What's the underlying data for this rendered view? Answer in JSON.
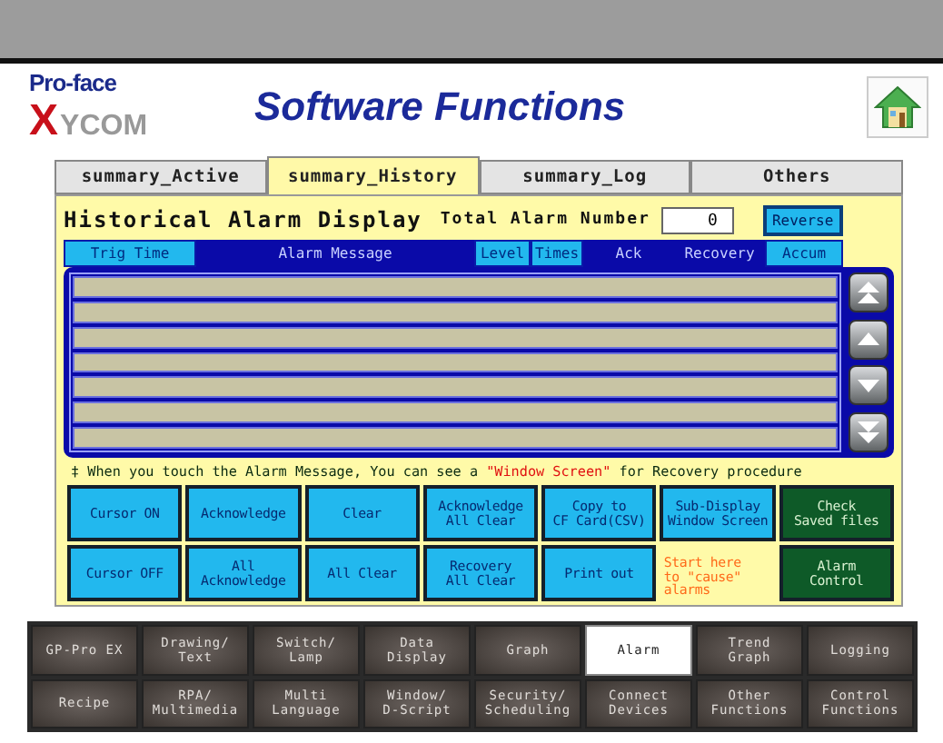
{
  "logo": {
    "top": "Pro-face",
    "mark": "X",
    "bottom": "YCOM"
  },
  "title": "Software Functions",
  "tabs": [
    {
      "label": "summary_Active",
      "selected": false
    },
    {
      "label": "summary_History",
      "selected": true
    },
    {
      "label": "summary_Log",
      "selected": false
    },
    {
      "label": "Others",
      "selected": false
    }
  ],
  "panel": {
    "heading": "Historical Alarm Display",
    "total_label": "Total Alarm Number",
    "total_value": "0",
    "reverse": "Reverse"
  },
  "columns": [
    {
      "label": "Trig Time",
      "kind": "button"
    },
    {
      "label": "Alarm Message",
      "kind": "label"
    },
    {
      "label": "Level",
      "kind": "button"
    },
    {
      "label": "Times",
      "kind": "button"
    },
    {
      "label": "Ack",
      "kind": "label"
    },
    {
      "label": "Recovery",
      "kind": "label"
    },
    {
      "label": "Accum",
      "kind": "button"
    }
  ],
  "footnote": {
    "before": "‡ When you touch the Alarm Message, You can see a ",
    "highlight": "\"Window Screen\"",
    "after": " for Recovery procedure"
  },
  "buttons": [
    {
      "label": "Cursor ON",
      "kind": "blue"
    },
    {
      "label": "Acknowledge",
      "kind": "blue"
    },
    {
      "label": "Clear",
      "kind": "blue"
    },
    {
      "label": "Acknowledge\nAll Clear",
      "kind": "blue"
    },
    {
      "label": "Copy to\nCF Card(CSV)",
      "kind": "blue"
    },
    {
      "label": "Sub-Display\nWindow Screen",
      "kind": "blue"
    },
    {
      "label": "Check\nSaved files",
      "kind": "green"
    },
    {
      "label": "Cursor OFF",
      "kind": "blue"
    },
    {
      "label": "All\nAcknowledge",
      "kind": "blue"
    },
    {
      "label": "All Clear",
      "kind": "blue"
    },
    {
      "label": "Recovery\nAll Clear",
      "kind": "blue"
    },
    {
      "label": "Print out",
      "kind": "blue"
    },
    {
      "label": "Start here\nto \"cause\"\nalarms",
      "kind": "note"
    },
    {
      "label": "Alarm\nControl",
      "kind": "green"
    }
  ],
  "nav": [
    {
      "label": "GP-Pro EX",
      "selected": false
    },
    {
      "label": "Drawing/\nText",
      "selected": false
    },
    {
      "label": "Switch/\nLamp",
      "selected": false
    },
    {
      "label": "Data\nDisplay",
      "selected": false
    },
    {
      "label": "Graph",
      "selected": false
    },
    {
      "label": "Alarm",
      "selected": true
    },
    {
      "label": "Trend\nGraph",
      "selected": false
    },
    {
      "label": "Logging",
      "selected": false
    },
    {
      "label": "Recipe",
      "selected": false
    },
    {
      "label": "RPA/\nMultimedia",
      "selected": false
    },
    {
      "label": "Multi\nLanguage",
      "selected": false
    },
    {
      "label": "Window/\nD-Script",
      "selected": false
    },
    {
      "label": "Security/\nScheduling",
      "selected": false
    },
    {
      "label": "Connect\nDevices",
      "selected": false
    },
    {
      "label": "Other\nFunctions",
      "selected": false
    },
    {
      "label": "Control\nFunctions",
      "selected": false
    }
  ]
}
